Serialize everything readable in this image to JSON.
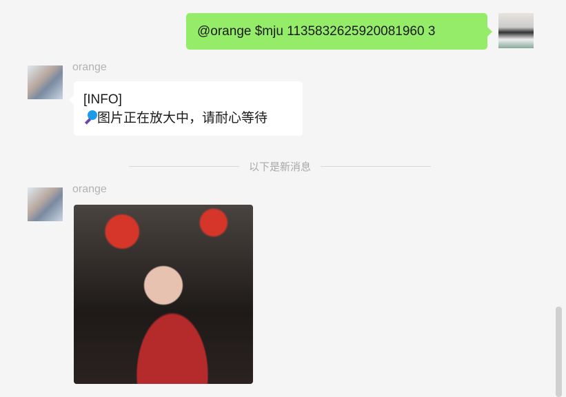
{
  "messages": [
    {
      "sender": "me",
      "text": "@orange $mju 1135832625920081960 3"
    },
    {
      "sender": "orange",
      "line1": "[INFO]",
      "icon": "magnifier-icon",
      "line2": "图片正在放大中，请耐心等待"
    },
    {
      "sender": "orange",
      "type": "image"
    }
  ],
  "divider": "以下是新消息",
  "colors": {
    "my_bubble": "#95ec69",
    "their_bubble": "#ffffff",
    "background": "#f5f5f5"
  }
}
